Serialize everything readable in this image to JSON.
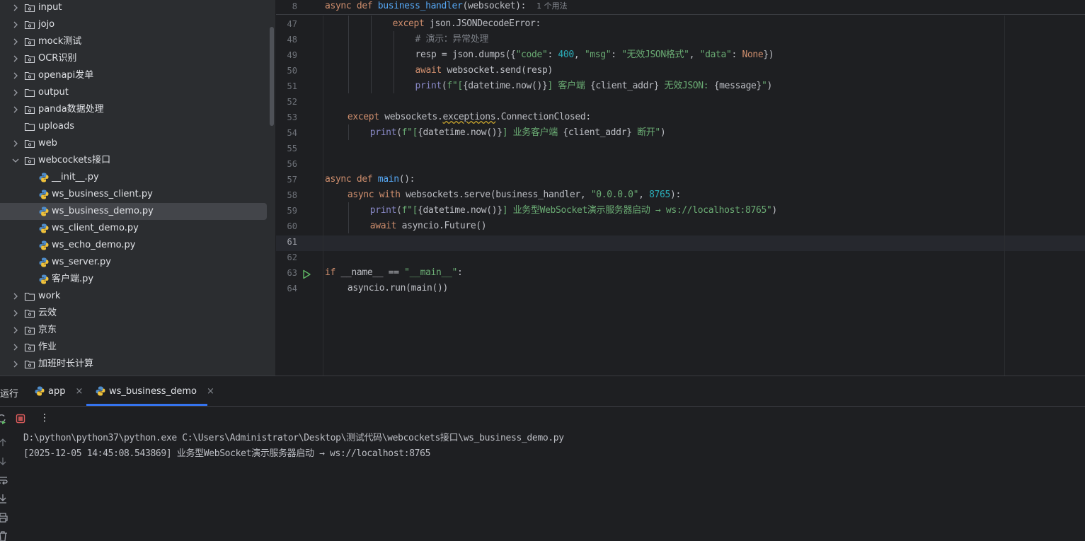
{
  "tree": {
    "items": [
      {
        "label": "input",
        "kind": "folder-pkg",
        "expandable": true,
        "indent": 0
      },
      {
        "label": "jojo",
        "kind": "folder-pkg",
        "expandable": true,
        "indent": 0
      },
      {
        "label": "mock测试",
        "kind": "folder-pkg",
        "expandable": true,
        "indent": 0
      },
      {
        "label": "OCR识别",
        "kind": "folder-pkg",
        "expandable": true,
        "indent": 0
      },
      {
        "label": "openapi发单",
        "kind": "folder-pkg",
        "expandable": true,
        "indent": 0
      },
      {
        "label": "output",
        "kind": "folder",
        "expandable": true,
        "indent": 0
      },
      {
        "label": "panda数据处理",
        "kind": "folder-pkg",
        "expandable": true,
        "indent": 0
      },
      {
        "label": "uploads",
        "kind": "folder",
        "expandable": false,
        "indent": 0
      },
      {
        "label": "web",
        "kind": "folder-pkg",
        "expandable": true,
        "indent": 0
      },
      {
        "label": "webcockets接口",
        "kind": "folder-pkg",
        "expandable": true,
        "expanded": true,
        "indent": 0
      },
      {
        "label": "__init__.py",
        "kind": "python-file",
        "expandable": false,
        "indent": 1
      },
      {
        "label": "ws_business_client.py",
        "kind": "python-file",
        "expandable": false,
        "indent": 1
      },
      {
        "label": "ws_business_demo.py",
        "kind": "python-file",
        "expandable": false,
        "indent": 1,
        "selected": true
      },
      {
        "label": "ws_client_demo.py",
        "kind": "python-file",
        "expandable": false,
        "indent": 1
      },
      {
        "label": "ws_echo_demo.py",
        "kind": "python-file",
        "expandable": false,
        "indent": 1
      },
      {
        "label": "ws_server.py",
        "kind": "python-file",
        "expandable": false,
        "indent": 1
      },
      {
        "label": "客户端.py",
        "kind": "python-file",
        "expandable": false,
        "indent": 1
      },
      {
        "label": "work",
        "kind": "folder",
        "expandable": true,
        "indent": 0
      },
      {
        "label": "云效",
        "kind": "folder-pkg",
        "expandable": true,
        "indent": 0
      },
      {
        "label": "京东",
        "kind": "folder-pkg",
        "expandable": true,
        "indent": 0
      },
      {
        "label": "作业",
        "kind": "folder-pkg",
        "expandable": true,
        "indent": 0
      },
      {
        "label": "加班时长计算",
        "kind": "folder-pkg",
        "expandable": true,
        "indent": 0
      }
    ]
  },
  "editor": {
    "sticky": {
      "line_number": "8",
      "tokens": [
        [
          "kw",
          "async "
        ],
        [
          "kw",
          "def "
        ],
        [
          "fn",
          "business_handler"
        ],
        [
          "",
          "(websocket):  "
        ],
        [
          "hint",
          "1 个用法"
        ]
      ]
    },
    "current_line": "61",
    "lines": [
      {
        "n": "47",
        "indent": 3,
        "tokens": [
          [
            "kw",
            "except "
          ],
          [
            "",
            "json.JSONDecodeError:"
          ]
        ]
      },
      {
        "n": "48",
        "indent": 4,
        "tokens": [
          [
            "cm",
            "# 演示：异常处理"
          ]
        ]
      },
      {
        "n": "49",
        "indent": 4,
        "tokens": [
          [
            "",
            "resp = json.dumps({"
          ],
          [
            "st",
            "\"code\""
          ],
          [
            "",
            ": "
          ],
          [
            "nm",
            "400"
          ],
          [
            "",
            ", "
          ],
          [
            "st",
            "\"msg\""
          ],
          [
            "",
            ": "
          ],
          [
            "st",
            "\"无效JSON格式\""
          ],
          [
            "",
            ", "
          ],
          [
            "st",
            "\"data\""
          ],
          [
            "",
            ": "
          ],
          [
            "kw",
            "None"
          ],
          [
            "",
            "})"
          ]
        ]
      },
      {
        "n": "50",
        "indent": 4,
        "tokens": [
          [
            "kw",
            "await "
          ],
          [
            "",
            "websocket.send(resp)"
          ]
        ]
      },
      {
        "n": "51",
        "indent": 4,
        "tokens": [
          [
            "bi",
            "print"
          ],
          [
            "",
            "("
          ],
          [
            "st",
            "f\"["
          ],
          [
            "",
            "{datetime.now()}"
          ],
          [
            "st",
            "] 客户端 "
          ],
          [
            "",
            "{client_addr}"
          ],
          [
            "st",
            " 无效JSON: "
          ],
          [
            "",
            "{message}"
          ],
          [
            "st",
            "\""
          ],
          [
            "",
            ")"
          ]
        ]
      },
      {
        "n": "52",
        "indent": 0,
        "tokens": []
      },
      {
        "n": "53",
        "indent": 1,
        "tokens": [
          [
            "kw",
            "except "
          ],
          [
            "",
            "websockets."
          ],
          [
            "warn",
            "exceptions"
          ],
          [
            "",
            ".ConnectionClosed:"
          ]
        ]
      },
      {
        "n": "54",
        "indent": 2,
        "tokens": [
          [
            "bi",
            "print"
          ],
          [
            "",
            "("
          ],
          [
            "st",
            "f\"["
          ],
          [
            "",
            "{datetime.now()}"
          ],
          [
            "st",
            "] 业务客户端 "
          ],
          [
            "",
            "{client_addr}"
          ],
          [
            "st",
            " 断开\""
          ],
          [
            "",
            ")"
          ]
        ]
      },
      {
        "n": "55",
        "indent": 0,
        "tokens": []
      },
      {
        "n": "56",
        "indent": 0,
        "tokens": []
      },
      {
        "n": "57",
        "indent": 0,
        "tokens": [
          [
            "kw",
            "async "
          ],
          [
            "kw",
            "def "
          ],
          [
            "fn",
            "main"
          ],
          [
            "",
            "():"
          ]
        ]
      },
      {
        "n": "58",
        "indent": 1,
        "tokens": [
          [
            "kw",
            "async with "
          ],
          [
            "",
            "websockets.serve(business_handler, "
          ],
          [
            "st",
            "\"0.0.0.0\""
          ],
          [
            "",
            ", "
          ],
          [
            "nm",
            "8765"
          ],
          [
            "",
            "):"
          ]
        ]
      },
      {
        "n": "59",
        "indent": 2,
        "tokens": [
          [
            "bi",
            "print"
          ],
          [
            "",
            "("
          ],
          [
            "st",
            "f\"["
          ],
          [
            "",
            "{datetime.now()}"
          ],
          [
            "st",
            "] 业务型WebSocket演示服务器启动 → ws://localhost:8765\""
          ],
          [
            "",
            ")"
          ]
        ]
      },
      {
        "n": "60",
        "indent": 2,
        "tokens": [
          [
            "kw",
            "await "
          ],
          [
            "",
            "asyncio.Future()"
          ]
        ]
      },
      {
        "n": "61",
        "indent": 0,
        "tokens": []
      },
      {
        "n": "62",
        "indent": 0,
        "tokens": []
      },
      {
        "n": "63",
        "indent": 0,
        "run_icon": true,
        "tokens": [
          [
            "kw",
            "if "
          ],
          [
            "",
            "__name__ == "
          ],
          [
            "st",
            "\"__main__\""
          ],
          [
            "",
            ":"
          ]
        ]
      },
      {
        "n": "64",
        "indent": 1,
        "tokens": [
          [
            "",
            "asyncio.run(main())"
          ]
        ]
      }
    ]
  },
  "run": {
    "title": "运行",
    "tabs": [
      {
        "label": "app",
        "close": "×",
        "active": false
      },
      {
        "label": "ws_business_demo",
        "close": "×",
        "active": true
      }
    ],
    "toolbar": {
      "more": "⋮"
    },
    "console": [
      "D:\\python\\python37\\python.exe C:\\Users\\Administrator\\Desktop\\测试代码\\webcockets接口\\ws_business_demo.py",
      "[2025-12-05 14:45:08.543869] 业务型WebSocket演示服务器启动 → ws://localhost:8765"
    ]
  },
  "colors": {
    "accent": "#3574f0",
    "keyword": "#cf8e6d",
    "function": "#56a8f5",
    "string": "#6aab73",
    "number": "#2aacb8",
    "run_green": "#5fb865",
    "stop_red": "#db5c5c"
  }
}
